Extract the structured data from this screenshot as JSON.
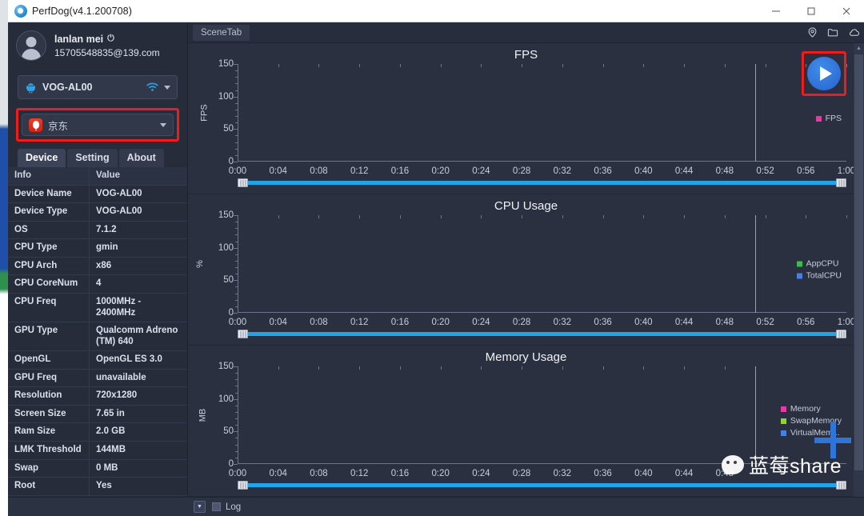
{
  "window": {
    "title": "PerfDog(v4.1.200708)",
    "logo_icon": "perfdog-logo-icon",
    "minimize_label": "—",
    "maximize_label": "☐",
    "close_label": "✕"
  },
  "sidebar": {
    "account": {
      "name": "lanlan mei",
      "power_icon": "⏻",
      "email": "15705548835@139.com",
      "avatar_icon": "avatar-icon"
    },
    "device_selector": {
      "label": "VOG-AL00",
      "device_icon": "android-icon",
      "connection_icon": "wifi-icon",
      "caret_icon": "chevron-down-icon"
    },
    "app_selector": {
      "label": "京东",
      "app_icon": "jd-app-icon",
      "caret_icon": "chevron-down-icon",
      "highlighted": true,
      "highlight_color": "#ee1c1c"
    },
    "tabs": [
      {
        "label": "Device",
        "active": true
      },
      {
        "label": "Setting",
        "active": false
      },
      {
        "label": "About",
        "active": false
      }
    ],
    "table": {
      "headers": [
        "Info",
        "Value"
      ],
      "rows": [
        [
          "Device Name",
          "VOG-AL00"
        ],
        [
          "Device Type",
          "VOG-AL00"
        ],
        [
          "OS",
          "7.1.2"
        ],
        [
          "CPU Type",
          "gmin"
        ],
        [
          "CPU Arch",
          "x86"
        ],
        [
          "CPU CoreNum",
          "4"
        ],
        [
          "CPU Freq",
          "1000MHz - 2400MHz"
        ],
        [
          "GPU Type",
          "Qualcomm Adreno (TM) 640"
        ],
        [
          "OpenGL",
          "OpenGL ES 3.0"
        ],
        [
          "GPU Freq",
          "unavailable"
        ],
        [
          "Resolution",
          "720x1280"
        ],
        [
          "Screen Size",
          "7.65 in"
        ],
        [
          "Ram Size",
          "2.0 GB"
        ],
        [
          "LMK Threshold",
          "144MB"
        ],
        [
          "Swap",
          "0 MB"
        ],
        [
          "Root",
          "Yes"
        ]
      ]
    }
  },
  "main": {
    "scene_tab": "SceneTab",
    "toolbar_icons": [
      {
        "name": "location-pin-icon"
      },
      {
        "name": "folder-icon"
      },
      {
        "name": "cloud-icon"
      }
    ],
    "play_button": {
      "name": "play-button",
      "highlighted": true,
      "highlight_color": "#ee1c1c",
      "color": "#2f6fd6"
    },
    "scroll_handle_glyph": "∣∣∣"
  },
  "watermark": {
    "text": "蓝莓share",
    "wechat_icon": "wechat-icon",
    "plus_icon": "plus-icon",
    "plus_color": "#2f74d8"
  },
  "statusbar": {
    "collapse_icon": "▼",
    "log_label": "Log"
  },
  "chart_data": [
    {
      "type": "line",
      "title": "FPS",
      "xlabel": "",
      "ylabel": "FPS",
      "ylim": [
        0,
        150
      ],
      "yticks": [
        0,
        50,
        100,
        150
      ],
      "xticks": [
        "0:00",
        "0:04",
        "0:08",
        "0:12",
        "0:16",
        "0:20",
        "0:24",
        "0:28",
        "0:32",
        "0:36",
        "0:40",
        "0:44",
        "0:48",
        "0:52",
        "0:56",
        "1:00"
      ],
      "grid": false,
      "legend_position": "right",
      "cursor_time": "0:51",
      "series": [
        {
          "name": "FPS",
          "color": "#e03ca8",
          "values": []
        }
      ]
    },
    {
      "type": "line",
      "title": "CPU Usage",
      "xlabel": "",
      "ylabel": "%",
      "ylim": [
        0,
        150
      ],
      "yticks": [
        0,
        50,
        100,
        150
      ],
      "xticks": [
        "0:00",
        "0:04",
        "0:08",
        "0:12",
        "0:16",
        "0:20",
        "0:24",
        "0:28",
        "0:32",
        "0:36",
        "0:40",
        "0:44",
        "0:48",
        "0:52",
        "0:56",
        "1:00"
      ],
      "grid": false,
      "legend_position": "right",
      "cursor_time": "0:51",
      "series": [
        {
          "name": "AppCPU",
          "color": "#3fb950",
          "values": []
        },
        {
          "name": "TotalCPU",
          "color": "#4a7fe0",
          "values": []
        }
      ]
    },
    {
      "type": "line",
      "title": "Memory Usage",
      "xlabel": "",
      "ylabel": "MB",
      "ylim": [
        0,
        150
      ],
      "yticks": [
        0,
        50,
        100,
        150
      ],
      "xticks": [
        "0:00",
        "0:04",
        "0:08",
        "0:12",
        "0:16",
        "0:20",
        "0:24",
        "0:28",
        "0:32",
        "0:36",
        "0:40",
        "0:44",
        "0:48"
      ],
      "grid": false,
      "legend_position": "right",
      "cursor_time": "0:51",
      "series": [
        {
          "name": "Memory",
          "color": "#e03ca8",
          "values": []
        },
        {
          "name": "SwapMemory",
          "color": "#8fd432",
          "values": []
        },
        {
          "name": "VirtualMem...",
          "color": "#4a7fe0",
          "values": []
        }
      ]
    }
  ]
}
